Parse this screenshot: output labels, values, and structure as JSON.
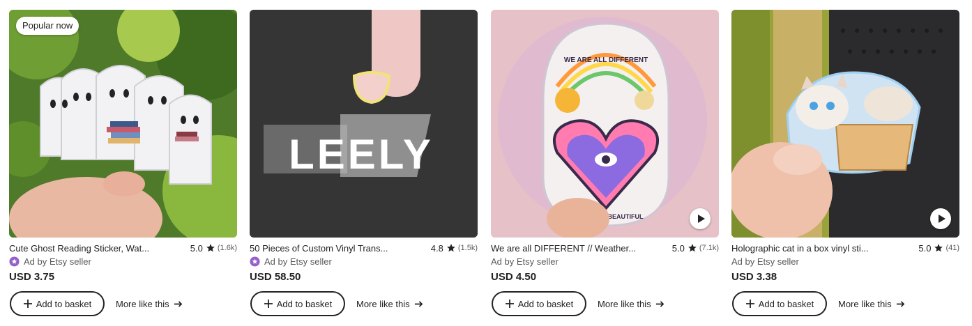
{
  "colors": {
    "ad_icon": "#9560c8",
    "text": "#222222",
    "muted": "#595959"
  },
  "icons": {
    "star": "star-icon",
    "ad": "ad-badge-icon",
    "plus": "plus-icon",
    "arrow": "arrow-right-icon",
    "play": "play-icon"
  },
  "listings": [
    {
      "badge": "Popular now",
      "title": "Cute Ghost Reading Sticker, Wat...",
      "rating": "5.0",
      "review_count": "(1.6k)",
      "seller": "Ad by Etsy seller",
      "price": "USD 3.75",
      "add_label": "Add to basket",
      "more_label": "More like this"
    },
    {
      "title": "50 Pieces of Custom Vinyl Trans...",
      "rating": "4.8",
      "review_count": "(1.5k)",
      "seller": "Ad by Etsy seller",
      "price": "USD 58.50",
      "add_label": "Add to basket",
      "more_label": "More like this",
      "image_text": "LEELY"
    },
    {
      "title": "We are all DIFFERENT // Weather...",
      "rating": "5.0",
      "review_count": "(7.1k)",
      "seller": "Ad by Etsy seller",
      "price": "USD 4.50",
      "add_label": "Add to basket",
      "more_label": "More like this",
      "image_text_top": "WE ARE ALL DIFFERENT",
      "image_text_bottom": "AND THAT'S BEAUTIFUL",
      "has_video": true
    },
    {
      "title": "Holographic cat in a box vinyl sti...",
      "rating": "5.0",
      "review_count": "(41)",
      "seller": "Ad by Etsy seller",
      "price": "USD 3.38",
      "add_label": "Add to basket",
      "more_label": "More like this",
      "has_video": true
    }
  ]
}
